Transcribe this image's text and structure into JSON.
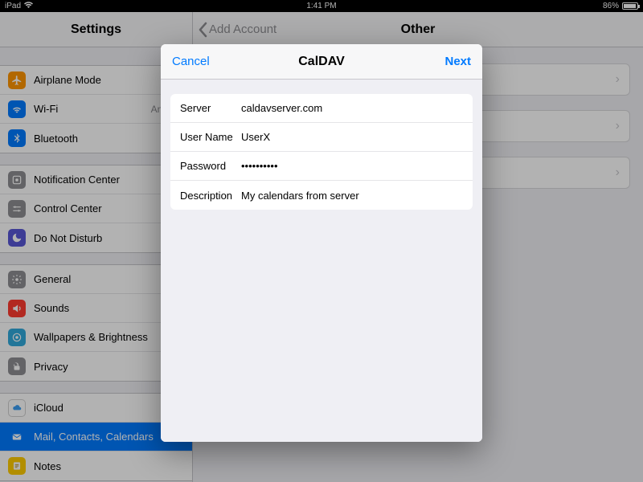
{
  "status": {
    "device": "iPad",
    "time": "1:41 PM",
    "battery": "86%"
  },
  "sidebar": {
    "title": "Settings",
    "groups": [
      [
        {
          "icon": "airplane",
          "color": "#ff9500",
          "label": "Airplane Mode"
        },
        {
          "icon": "wifi",
          "color": "#007aff",
          "label": "Wi-Fi",
          "value": "Andr…"
        },
        {
          "icon": "bluetooth",
          "color": "#007aff",
          "label": "Bluetooth"
        }
      ],
      [
        {
          "icon": "notif",
          "color": "#8e8e93",
          "label": "Notification Center"
        },
        {
          "icon": "control",
          "color": "#8e8e93",
          "label": "Control Center"
        },
        {
          "icon": "dnd",
          "color": "#5856d6",
          "label": "Do Not Disturb"
        }
      ],
      [
        {
          "icon": "general",
          "color": "#8e8e93",
          "label": "General"
        },
        {
          "icon": "sounds",
          "color": "#ff3b30",
          "label": "Sounds"
        },
        {
          "icon": "wallpaper",
          "color": "#32aadc",
          "label": "Wallpapers & Brightness"
        },
        {
          "icon": "privacy",
          "color": "#8e8e93",
          "label": "Privacy"
        }
      ],
      [
        {
          "icon": "icloud",
          "color": "#ffffff",
          "label": "iCloud"
        },
        {
          "icon": "mail",
          "color": "#007aff",
          "label": "Mail, Contacts, Calendars",
          "selected": true
        },
        {
          "icon": "notes",
          "color": "#ffcc00",
          "label": "Notes"
        }
      ]
    ]
  },
  "detail": {
    "back": "Add Account",
    "title": "Other"
  },
  "modal": {
    "cancel": "Cancel",
    "title": "CalDAV",
    "next": "Next",
    "fields": [
      {
        "label": "Server",
        "value": "caldavserver.com",
        "type": "text"
      },
      {
        "label": "User Name",
        "value": "UserX",
        "type": "text"
      },
      {
        "label": "Password",
        "value": "••••••••••",
        "type": "text"
      },
      {
        "label": "Description",
        "value": "My calendars from server",
        "type": "text"
      }
    ]
  }
}
